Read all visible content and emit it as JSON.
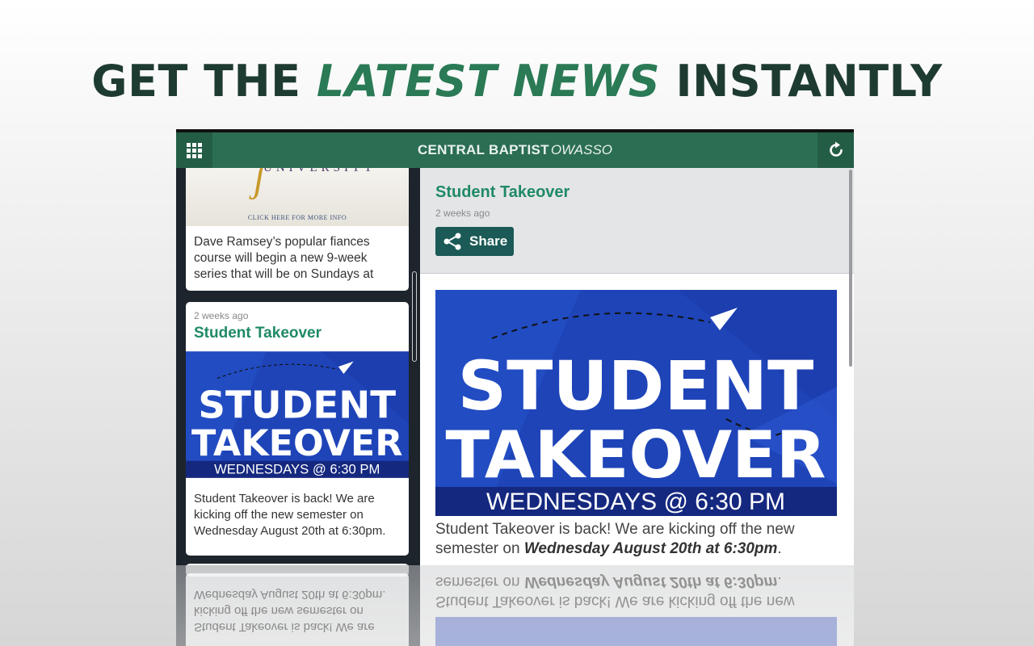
{
  "headline": {
    "part1": "GET THE ",
    "accent": "LATEST NEWS",
    "part2": " INSTANTLY"
  },
  "app": {
    "brand_bold": "CENTRAL BAPTIST",
    "brand_italic": "OWASSO",
    "menu_icon": "grid-icon",
    "refresh_icon": "refresh-icon",
    "accent_color": "#2b6e53"
  },
  "feed": {
    "items": [
      {
        "image_word": "UNIVERSITY",
        "image_caption": "CLICK HERE FOR MORE INFO",
        "excerpt": "Dave Ramsey’s popular fiances course will begin a new 9-week series that will be on Sundays at"
      },
      {
        "time": "2 weeks ago",
        "title": "Student Takeover",
        "excerpt": "Student Takeover is back! We are kicking off the new semester on Wednesday August 20th at 6:30pm."
      }
    ]
  },
  "graphic": {
    "line1": "STUDENT",
    "line2": "TAKEOVER",
    "line3": "WEDNESDAYS @ 6:30 PM"
  },
  "detail": {
    "title": "Student Takeover",
    "time": "2 weeks ago",
    "share_label": "Share",
    "body_intro": "Student Takeover is back! We are kicking off the new semester on ",
    "body_bold": "Wednesday August 20th at 6:30pm",
    "body_end": "."
  }
}
